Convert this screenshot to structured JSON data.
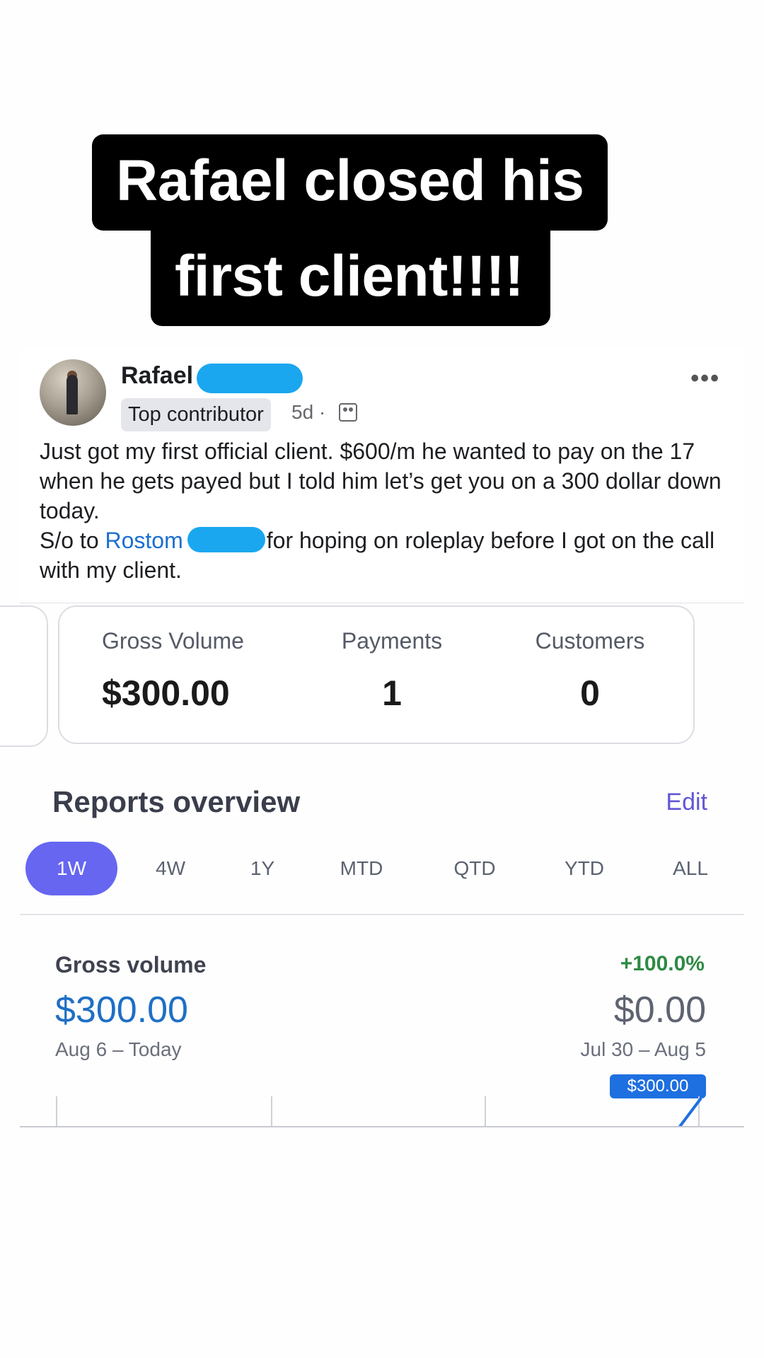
{
  "caption": {
    "line1": "Rafael closed his",
    "line2": "first client!!!!"
  },
  "post": {
    "author": "Rafael",
    "badge": "Top contributor",
    "time": "5d ·",
    "text_part1": "Just got my first official client. $600/m he wanted to pay on the 17 when he gets payed but I told him let’s get you on a 300 dollar down today.",
    "text_part2_prefix": "S/o to ",
    "mention": "Rostom",
    "text_part2_suffix": "for hoping on roleplay before I got on the call with my client.",
    "icons": [
      "more-icon",
      "group-icon",
      "avatar"
    ]
  },
  "summary": {
    "gross_label": "Gross Volume",
    "gross_value": "$300.00",
    "payments_label": "Payments",
    "payments_value": "1",
    "customers_label": "Customers",
    "customers_value": "0"
  },
  "reports": {
    "title": "Reports overview",
    "edit": "Edit",
    "tabs": [
      "1W",
      "4W",
      "1Y",
      "MTD",
      "QTD",
      "YTD",
      "ALL"
    ],
    "active_tab": "1W",
    "gross_volume_label": "Gross volume",
    "change": "+100.0%",
    "current_value": "$300.00",
    "previous_value": "$0.00",
    "current_range": "Aug 6 – Today",
    "previous_range": "Jul 30 – Aug 5",
    "tooltip": "$300.00"
  },
  "colors": {
    "accent": "#6666f1",
    "link": "#1b6fd1",
    "positive": "#2e8a44",
    "redaction": "#1aa7ef"
  }
}
